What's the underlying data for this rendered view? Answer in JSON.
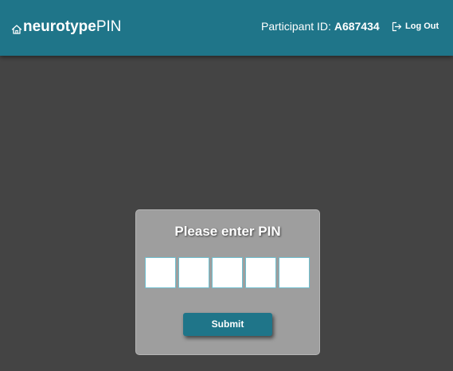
{
  "header": {
    "brand": {
      "icon": "home-icon",
      "bold_text": "neurotype",
      "light_text": "PIN"
    },
    "participant_label": "Participant ID:",
    "participant_id": "A687434",
    "logout": {
      "icon": "logout-icon",
      "label": "Log Out"
    },
    "background_color": "#1f7589"
  },
  "pin_card": {
    "title": "Please enter PIN",
    "pin_boxes": [
      {
        "value": ""
      },
      {
        "value": ""
      },
      {
        "value": ""
      },
      {
        "value": ""
      },
      {
        "value": ""
      }
    ],
    "submit_label": "Submit"
  },
  "colors": {
    "page_background": "#444444",
    "card_background": "#9e9e9e",
    "accent": "#1f7589",
    "pin_border": "#6fbfcf"
  }
}
